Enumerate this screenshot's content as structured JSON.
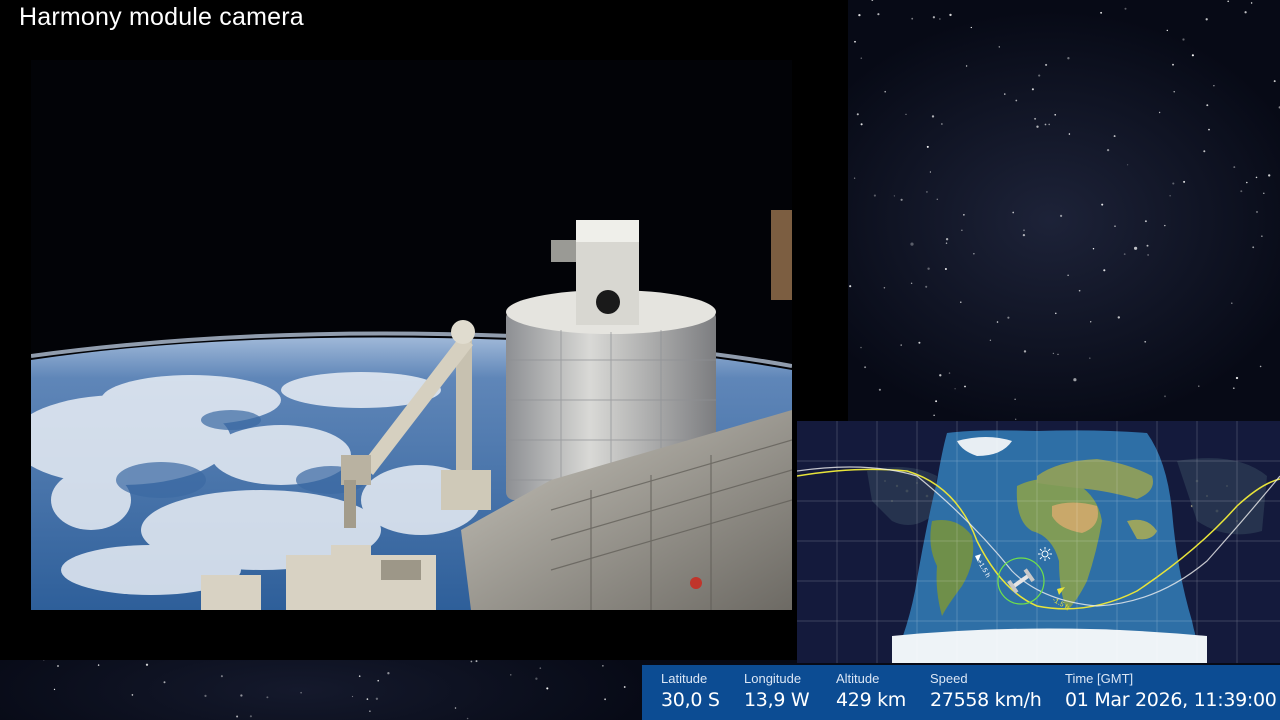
{
  "camera": {
    "title": "Harmony module camera"
  },
  "map": {
    "icons": [
      "iss-icon",
      "sun-icon"
    ],
    "colors": {
      "ocean": "#2e6fa6",
      "night": "#141a3c",
      "orbit_current": "#e8e43a",
      "orbit_next": "#f0f0f0",
      "grid": "#ffffff"
    },
    "orbit_labels": [
      "+1.5 h",
      "-1.5 h"
    ]
  },
  "telemetry": {
    "latitude": {
      "label": "Latitude",
      "value": "30,0 S"
    },
    "longitude": {
      "label": "Longitude",
      "value": "13,9 W"
    },
    "altitude": {
      "label": "Altitude",
      "value": "429 km"
    },
    "speed": {
      "label": "Speed",
      "value": "27558 km/h"
    },
    "time": {
      "label": "Time [GMT]",
      "value": "01 Mar 2026, 11:39:00"
    }
  },
  "colors": {
    "telemetry_bg": "#0c4c93",
    "feed_bg": "#000000"
  }
}
